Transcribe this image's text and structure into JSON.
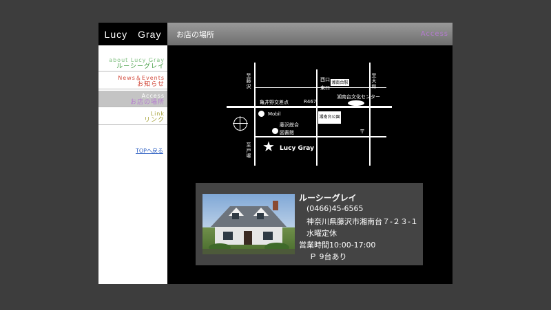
{
  "header": {
    "logo": "Lucy　Gray",
    "page_title": "お店の場所",
    "page_title_en": "Access"
  },
  "sidebar": {
    "items": [
      {
        "en": "about Lucy Gray",
        "jp": "ルーシーグレイ",
        "color": "#7fbf7f"
      },
      {
        "en": "News＆Events",
        "jp": "お知らせ",
        "color": "#d24a3c"
      },
      {
        "en": "Access",
        "jp": "お店の場所",
        "color": "#b57ad0",
        "active": true
      },
      {
        "en": "Link",
        "jp": "リンク",
        "color": "#a6a23a"
      }
    ],
    "top_link": "TOPへ戻る"
  },
  "map": {
    "labels": {
      "kameino": "亀井野交差点",
      "route": "R467",
      "culture": "湖南台文化センター",
      "mobil": "Mobil",
      "library": "藤沢総合 図書館",
      "lucy": "Lucy Gray",
      "west_exit": "西口",
      "east_exit": "東口",
      "station": "湘南台駅",
      "park": "湘南台公園",
      "to_fujisawa": "至藤沢",
      "to_yamato": "至大和",
      "to_totsuka": "至戸塚"
    }
  },
  "info": {
    "name": "ルーシーグレイ",
    "phone": "(0466)45-6565",
    "address": "神奈川県藤沢市湘南台７-２３-１",
    "closed": "水曜定休",
    "hours": "営業時間10:00-17:00",
    "parking": "Ｐ 9台あり"
  }
}
